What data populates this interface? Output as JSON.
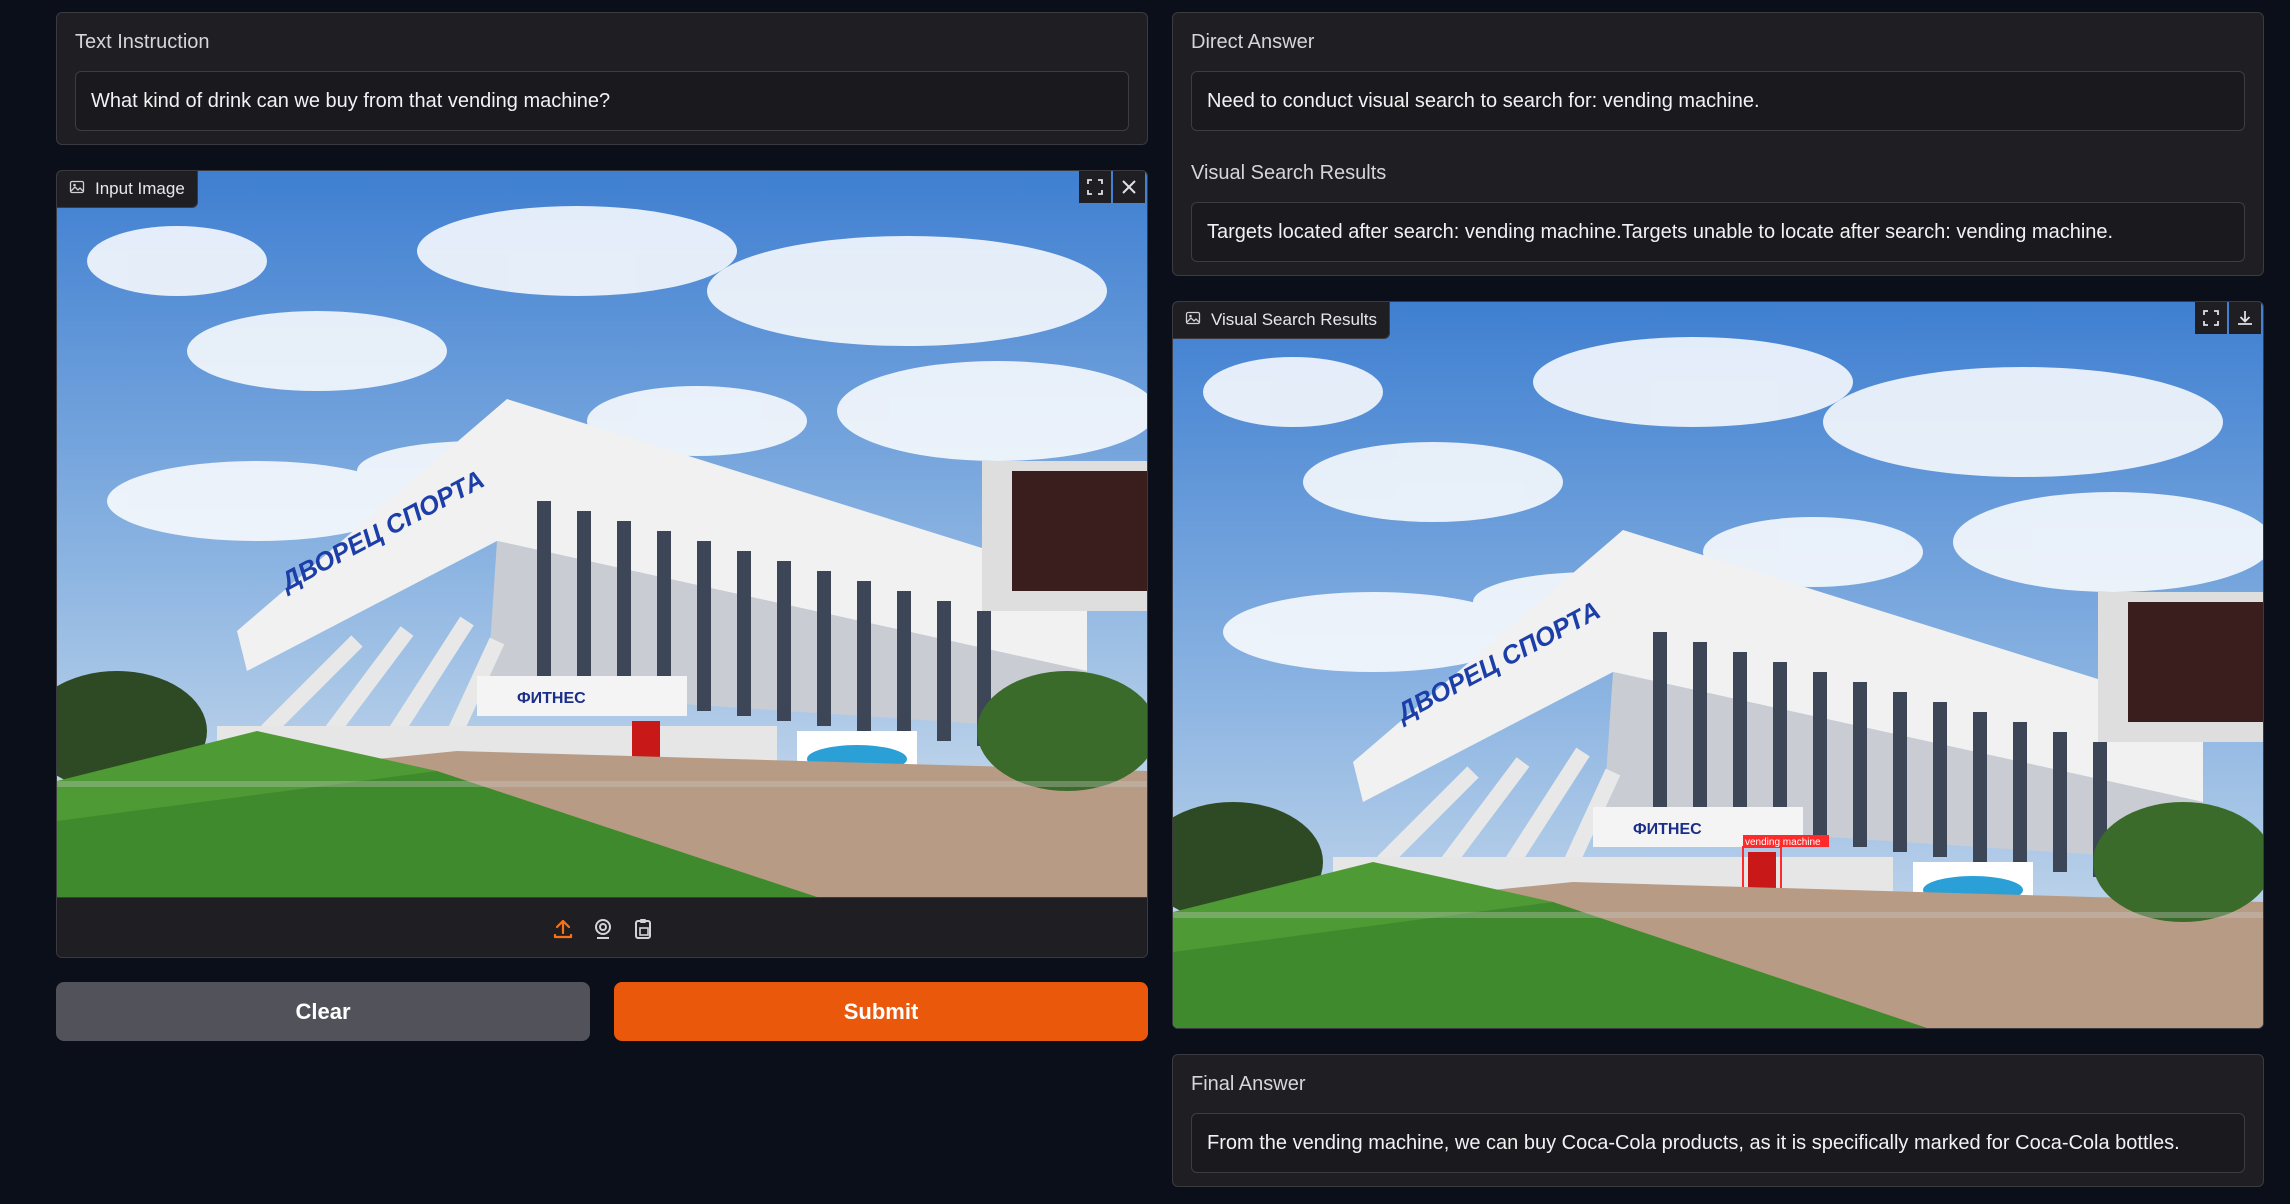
{
  "text_instruction": {
    "label": "Text Instruction",
    "value": "What kind of drink can we buy from that vending machine?"
  },
  "input_image": {
    "label": "Input Image",
    "sign_text": "ДВОРЕЦ СПОРТА",
    "fitness_text": "ФИТНЕС",
    "icons": [
      "image-icon",
      "fullscreen-icon",
      "close-icon",
      "upload-icon",
      "webcam-icon",
      "clipboard-icon"
    ]
  },
  "buttons": {
    "clear": "Clear",
    "submit": "Submit"
  },
  "direct_answer": {
    "label": "Direct Answer",
    "value": "Need to conduct visual search to search for: vending machine."
  },
  "visual_search_text": {
    "label": "Visual Search Results",
    "value": "Targets located after search: vending machine.Targets unable to locate after search: vending machine."
  },
  "visual_search_image": {
    "label": "Visual Search Results",
    "sign_text": "ДВОРЕЦ СПОРТА",
    "fitness_text": "ФИТНЕС",
    "detection_label": "vending machine",
    "icons": [
      "image-icon",
      "fullscreen-icon",
      "download-icon"
    ]
  },
  "final_answer": {
    "label": "Final Answer",
    "value": "From the vending machine, we can buy Coca-Cola products, as it is specifically marked for Coca-Cola bottles."
  },
  "colors": {
    "background": "#0b0f19",
    "panel": "#1f1f23",
    "accent_orange": "#ea580c",
    "clear_button": "#52525b"
  }
}
